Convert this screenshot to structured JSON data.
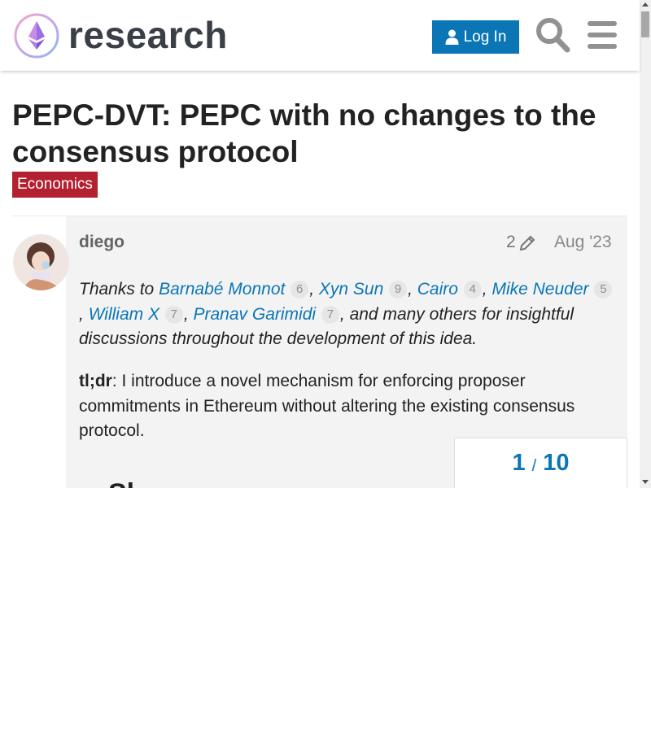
{
  "header": {
    "site_name": "research",
    "login_label": "Log In",
    "icons": [
      "ethereum-logo",
      "user-icon",
      "search-icon",
      "hamburger-menu-icon"
    ]
  },
  "topic": {
    "title": "PEPC-DVT: PEPC with no changes to the consensus protocol",
    "category": "Economics",
    "category_color": "#b3202f"
  },
  "post": {
    "author": "diego",
    "edit_count": "2",
    "date": "Aug '23",
    "thanks_prefix": "Thanks to ",
    "mentions": [
      {
        "name": "Barnabé Monnot",
        "count": "6"
      },
      {
        "name": "Xyn Sun",
        "count": "9"
      },
      {
        "name": "Cairo",
        "count": "4"
      },
      {
        "name": "Mike Neuder",
        "count": "5"
      },
      {
        "name": "William X",
        "count": "7"
      },
      {
        "name": "Pranav Garimidi",
        "count": "7"
      }
    ],
    "thanks_suffix": ", and many others for insightful discussions throughout the development of this idea.",
    "tldr_label": "tl;dr",
    "tldr_text": ": I introduce a novel mechanism for enforcing proposer commitments in Ethereum without altering the existing consensus protocol.",
    "partial_heading": "Sl"
  },
  "progress": {
    "current": "1",
    "separator": "/",
    "total": "10"
  },
  "colors": {
    "accent": "#0a76b6",
    "post_background": "#f3f3f3"
  }
}
